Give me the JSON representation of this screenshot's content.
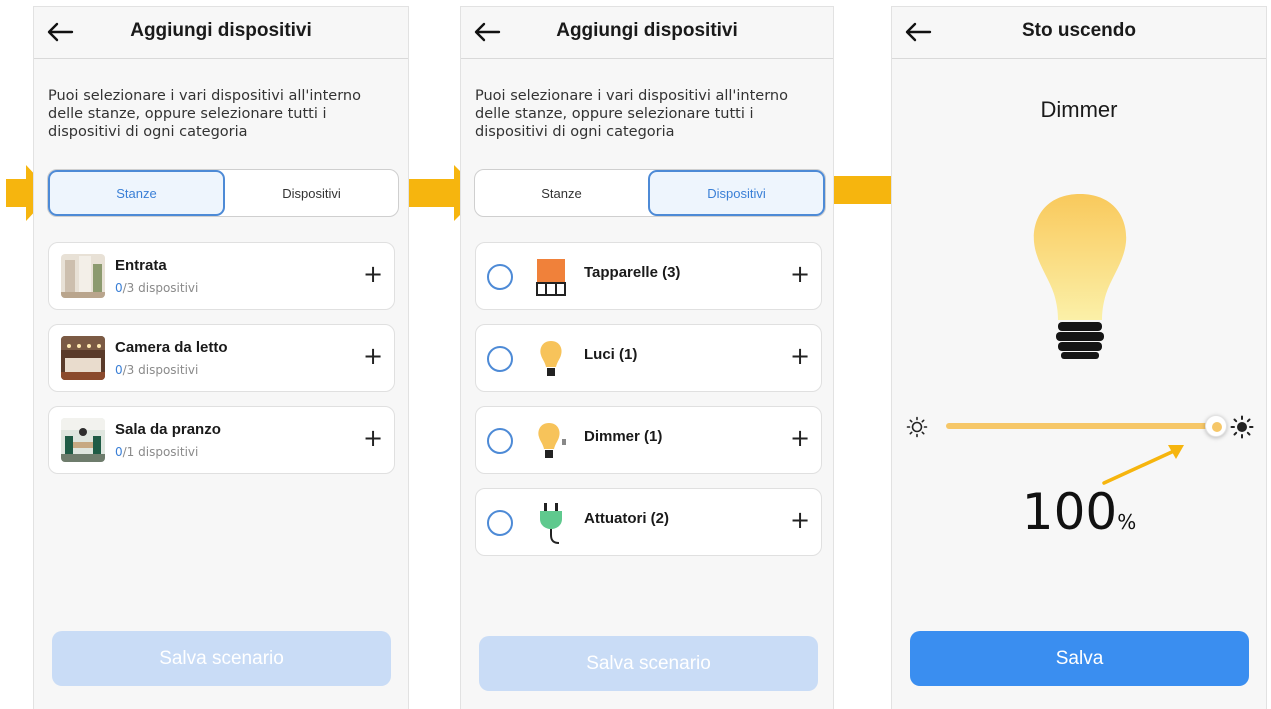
{
  "screen1": {
    "title": "Aggiungi dispositivi",
    "intro": "Puoi selezionare i vari dispositivi all'interno delle stanze, oppure selezionare tutti i dispositivi di ogni categoria",
    "tabs": [
      {
        "label": "Stanze",
        "active": true
      },
      {
        "label": "Dispositivi",
        "active": false
      }
    ],
    "rooms": [
      {
        "name": "Entrata",
        "selected": "0",
        "count": "/3 dispositivi"
      },
      {
        "name": "Camera da letto",
        "selected": "0",
        "count": "/3 dispositivi"
      },
      {
        "name": "Sala da pranzo",
        "selected": "0",
        "count": "/1 dispositivi"
      }
    ],
    "save_label": "Salva scenario"
  },
  "screen2": {
    "title": "Aggiungi dispositivi",
    "intro": "Puoi selezionare i vari dispositivi all'interno delle stanze, oppure selezionare tutti i dispositivi di ogni categoria",
    "tabs": [
      {
        "label": "Stanze",
        "active": false
      },
      {
        "label": "Dispositivi",
        "active": true
      }
    ],
    "devices": [
      {
        "name": "Tapparelle (3)",
        "icon": "shutter-icon"
      },
      {
        "name": "Luci (1)",
        "icon": "light-bulb-icon"
      },
      {
        "name": "Dimmer (1)",
        "icon": "dimmer-icon"
      },
      {
        "name": "Attuatori (2)",
        "icon": "plug-icon"
      }
    ],
    "save_label": "Salva scenario"
  },
  "screen3": {
    "title": "Sto uscendo",
    "device_title": "Dimmer",
    "brightness_percent": 100,
    "value": "100",
    "unit": "%",
    "save_label": "Salva"
  },
  "plus_label": "+",
  "colors": {
    "accent": "#3a8ef0",
    "accent_disabled": "#c9dcf6",
    "active_tab_border": "#4d8ad6",
    "annotation_arrow": "#f6b50e",
    "slider": "#f6c768",
    "shutter": "#f0813a",
    "plug": "#5fc98e"
  }
}
